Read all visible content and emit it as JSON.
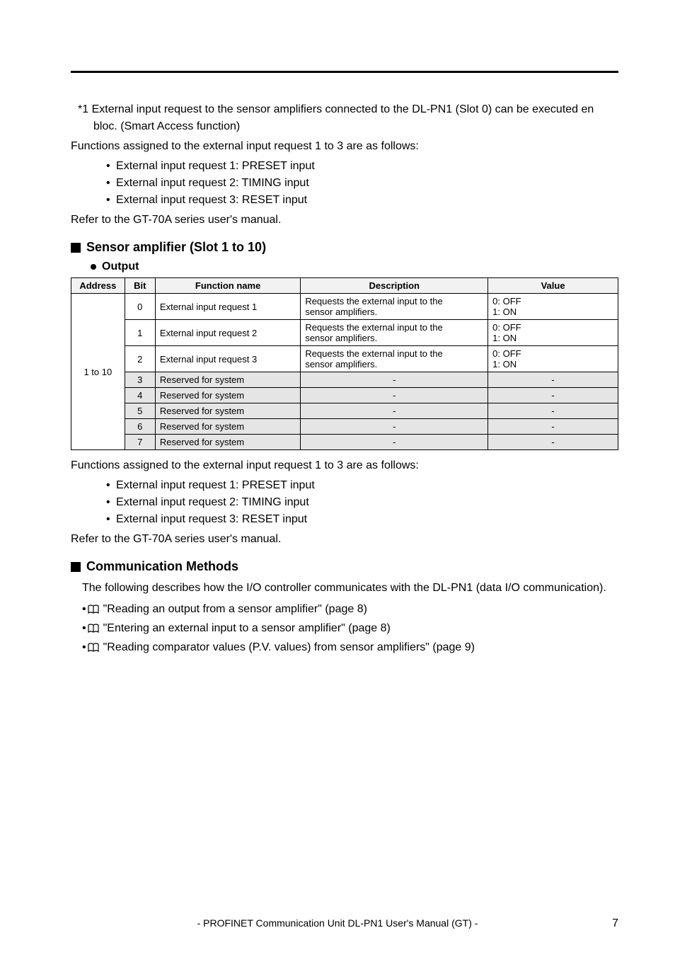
{
  "note1": "*1  External input request to the sensor amplifiers connected to the DL-PN1 (Slot 0) can be executed en bloc. (Smart Access function)",
  "functions_intro": "Functions assigned to the external input request 1 to 3 are as follows:",
  "func_bullets": [
    "External input request 1: PRESET input",
    "External input request 2: TIMING input",
    "External input request 3: RESET input"
  ],
  "refer_text": "Refer to the GT-70A series user's manual.",
  "sensor_heading": "Sensor amplifier (Slot 1 to 10)",
  "output_heading": "Output",
  "table": {
    "headers": {
      "address": "Address",
      "bit": "Bit",
      "function_name": "Function name",
      "description": "Description",
      "value": "Value"
    },
    "address_value": "1 to 10",
    "rows": [
      {
        "bit": "0",
        "func": "External input request 1",
        "desc_l1": "Requests the external input to the",
        "desc_l2": "sensor amplifiers.",
        "val_l1": "0: OFF",
        "val_l2": "1: ON",
        "shaded": false
      },
      {
        "bit": "1",
        "func": "External input request 2",
        "desc_l1": "Requests the external input to the",
        "desc_l2": "sensor amplifiers.",
        "val_l1": "0: OFF",
        "val_l2": "1: ON",
        "shaded": false
      },
      {
        "bit": "2",
        "func": "External input request 3",
        "desc_l1": "Requests the external input to the",
        "desc_l2": "sensor amplifiers.",
        "val_l1": "0: OFF",
        "val_l2": "1: ON",
        "shaded": false
      },
      {
        "bit": "3",
        "func": "Reserved for system",
        "desc": "-",
        "val": "-",
        "shaded": true
      },
      {
        "bit": "4",
        "func": "Reserved for system",
        "desc": "-",
        "val": "-",
        "shaded": true
      },
      {
        "bit": "5",
        "func": "Reserved for system",
        "desc": "-",
        "val": "-",
        "shaded": true
      },
      {
        "bit": "6",
        "func": "Reserved for system",
        "desc": "-",
        "val": "-",
        "shaded": true
      },
      {
        "bit": "7",
        "func": "Reserved for system",
        "desc": "-",
        "val": "-",
        "shaded": true
      }
    ]
  },
  "comm_heading": "Communication Methods",
  "comm_intro": "The following describes how the I/O controller communicates with the DL-PN1 (data I/O communication).",
  "comm_links": [
    "\"Reading an output from a sensor amplifier\" (page 8)",
    "\"Entering an external input to a sensor amplifier\" (page 8)",
    "\"Reading comparator values (P.V. values) from sensor amplifiers\" (page 9)"
  ],
  "footer": "- PROFINET Communication Unit DL-PN1 User's Manual (GT) -",
  "page_number": "7"
}
